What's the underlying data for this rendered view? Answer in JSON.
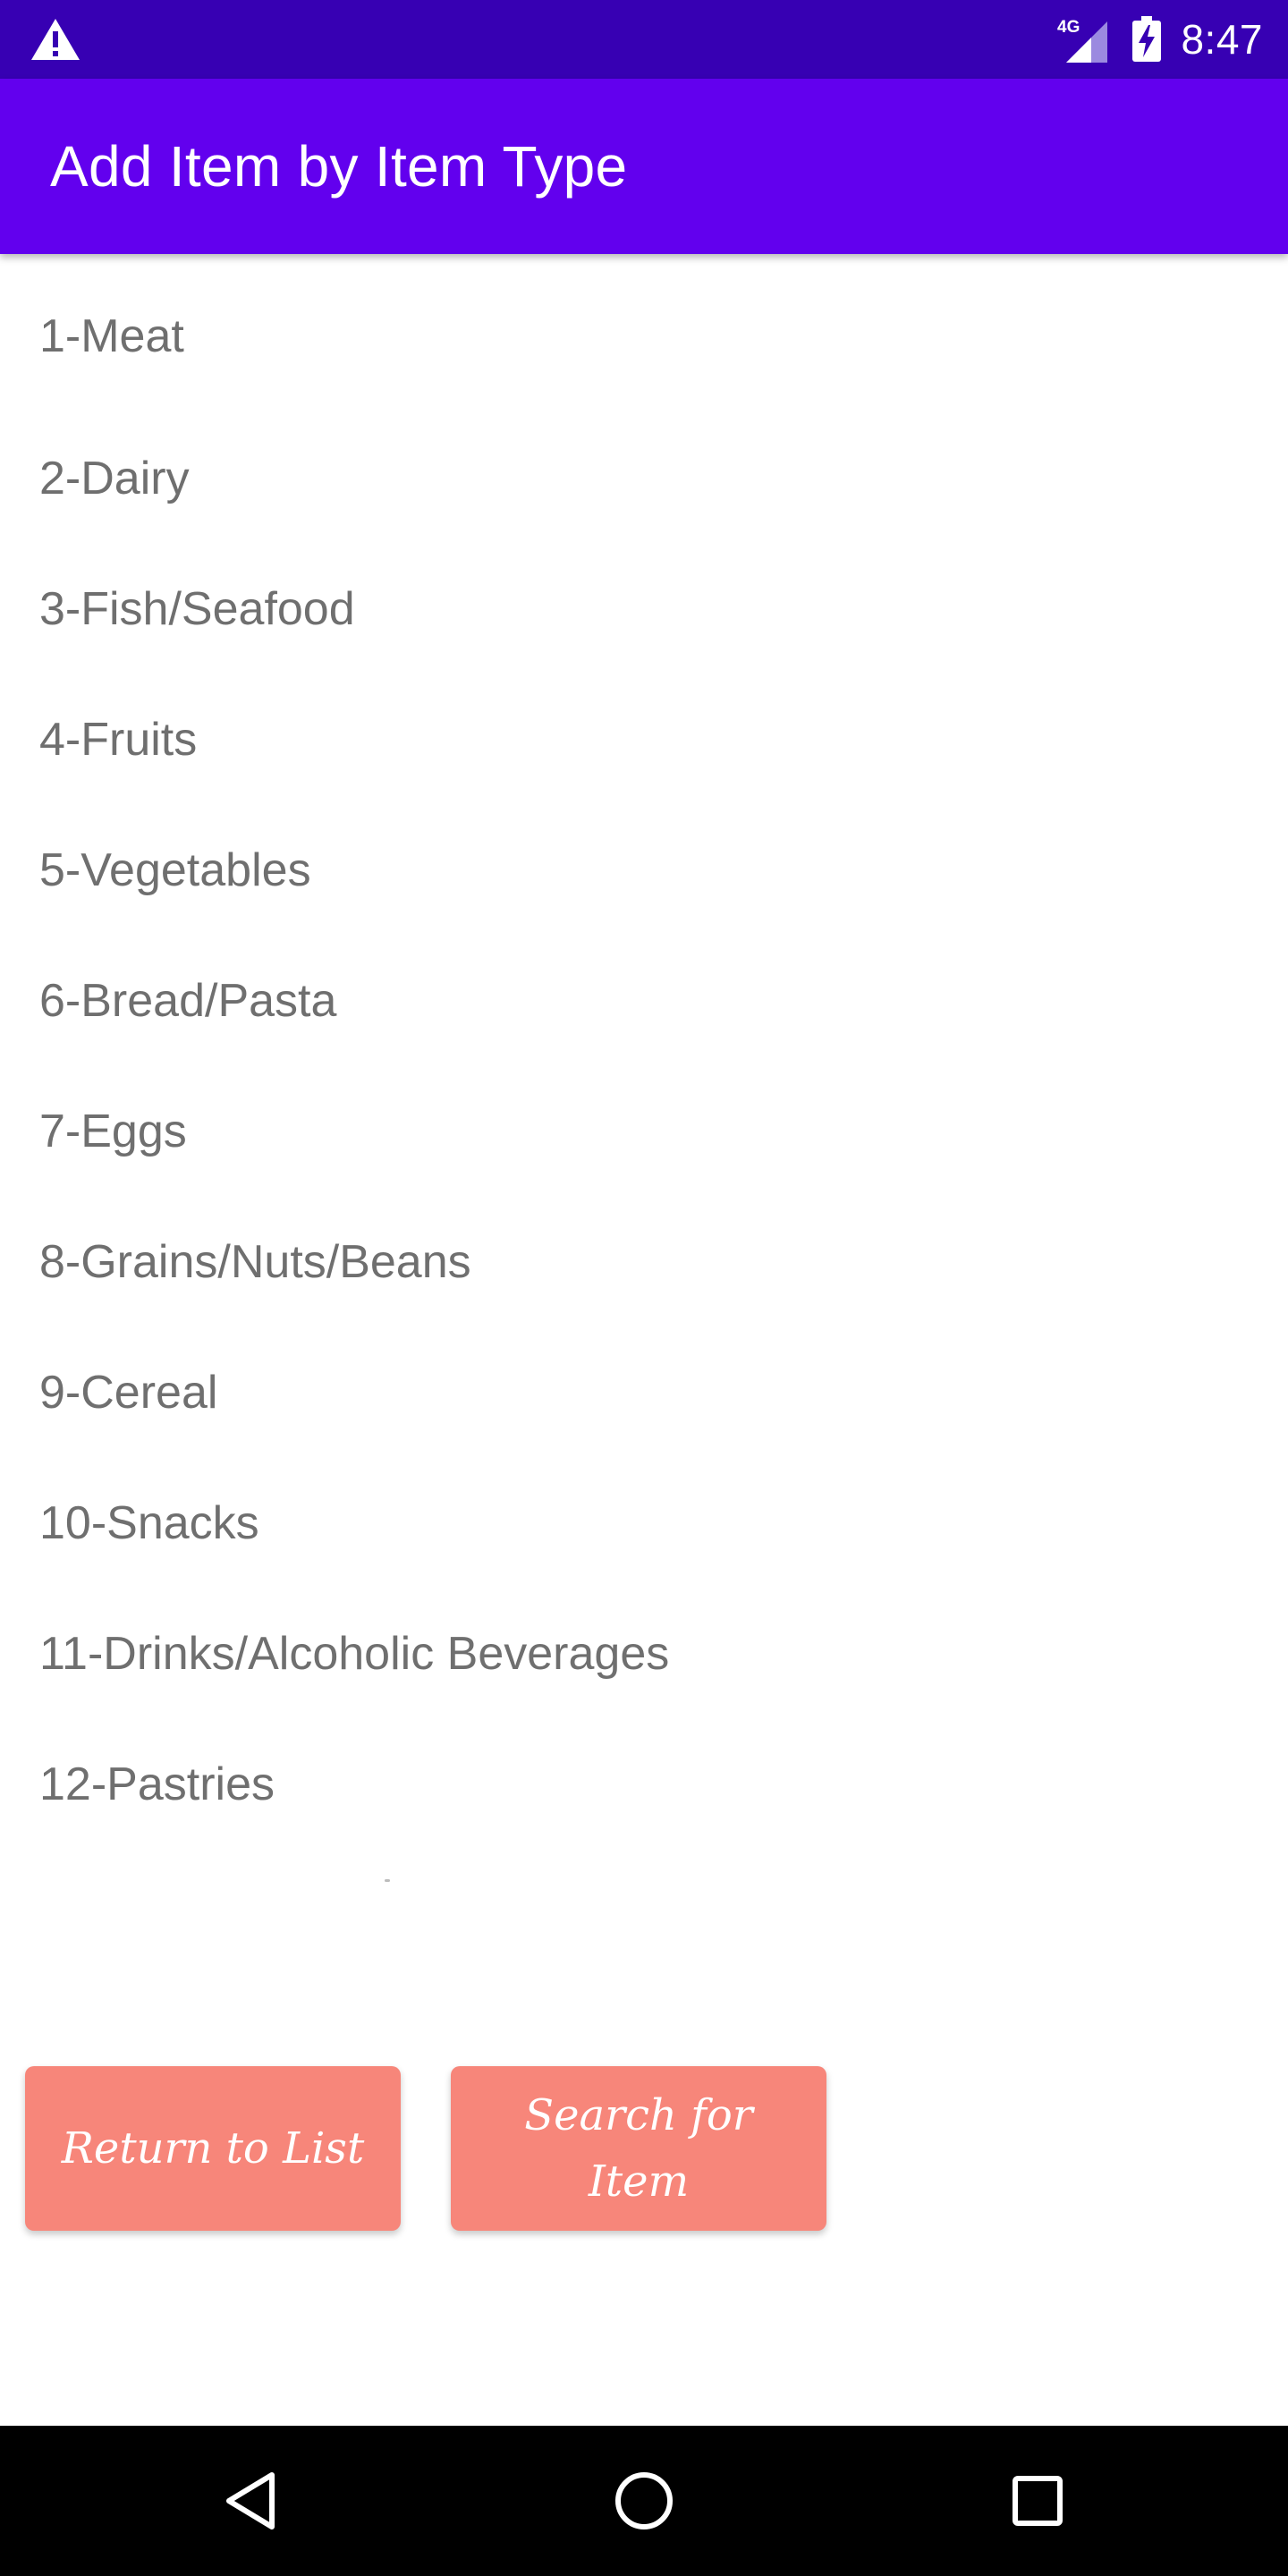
{
  "status_bar": {
    "time": "8:47",
    "network": "4G",
    "warning_icon": "warning-icon",
    "signal_icon": "signal-icon",
    "battery_icon": "battery-charging-icon"
  },
  "app_bar": {
    "title": "Add Item by Item Type"
  },
  "item_types": [
    "1-Meat",
    "2-Dairy",
    "3-Fish/Seafood",
    "4-Fruits",
    "5-Vegetables",
    "6-Bread/Pasta",
    "7-Eggs",
    "8-Grains/Nuts/Beans",
    "9-Cereal",
    "10-Snacks",
    "11-Drinks/Alcoholic Beverages",
    "12-Pastries"
  ],
  "buttons": {
    "return_label": "Return to List",
    "search_label": "Search for Item"
  },
  "colors": {
    "status_bar": "#3700b3",
    "app_bar": "#6200ee",
    "button": "#f7867a",
    "list_text": "#6f6f6f"
  },
  "nav_bar": {
    "back_icon": "back-triangle-icon",
    "home_icon": "home-circle-icon",
    "recents_icon": "recents-square-icon"
  }
}
